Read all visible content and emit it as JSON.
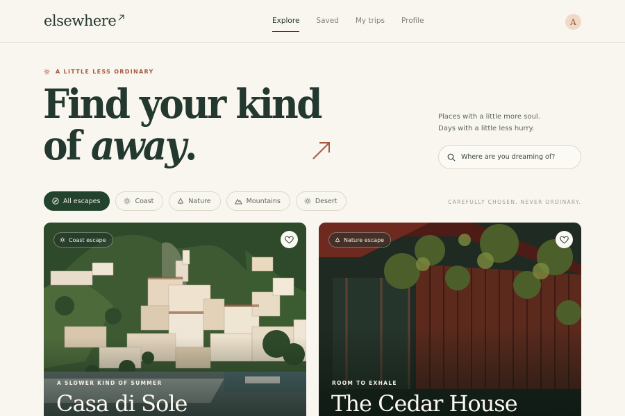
{
  "brand": {
    "name": "elsewhere"
  },
  "nav": [
    {
      "label": "Explore",
      "active": true
    },
    {
      "label": "Saved",
      "active": false
    },
    {
      "label": "My trips",
      "active": false
    },
    {
      "label": "Profile",
      "active": false
    }
  ],
  "user": {
    "avatar_initial": "A"
  },
  "hero": {
    "eyebrow": "A LITTLE LESS ORDINARY",
    "headline_line1": "Find your kind",
    "headline_line2_prefix": "of ",
    "headline_line2_emphasis": "away",
    "headline_line2_suffix": ".",
    "tagline_line1": "Places with a little more soul.",
    "tagline_line2": "Days with a little less hurry."
  },
  "search": {
    "placeholder": "Where are you dreaming of?",
    "value": ""
  },
  "filters": [
    {
      "label": "All escapes",
      "icon": "compass-icon",
      "active": true
    },
    {
      "label": "Coast",
      "icon": "sun-icon",
      "active": false
    },
    {
      "label": "Nature",
      "icon": "tree-icon",
      "active": false
    },
    {
      "label": "Mountains",
      "icon": "mountain-icon",
      "active": false
    },
    {
      "label": "Desert",
      "icon": "sun-icon",
      "active": false
    }
  ],
  "motto": "CAREFULLY CHOSEN. NEVER ORDINARY.",
  "cards": [
    {
      "badge": "Coast escape",
      "badge_icon": "sun-icon",
      "kicker": "A SLOWER KIND OF SUMMER",
      "title": "Casa di Sole"
    },
    {
      "badge": "Nature escape",
      "badge_icon": "tree-icon",
      "kicker": "ROOM TO EXHALE",
      "title": "The Cedar House"
    }
  ],
  "colors": {
    "background": "#f9f6ef",
    "ink": "#23382f",
    "accent": "#a8583f",
    "active_chip": "#23432f"
  }
}
